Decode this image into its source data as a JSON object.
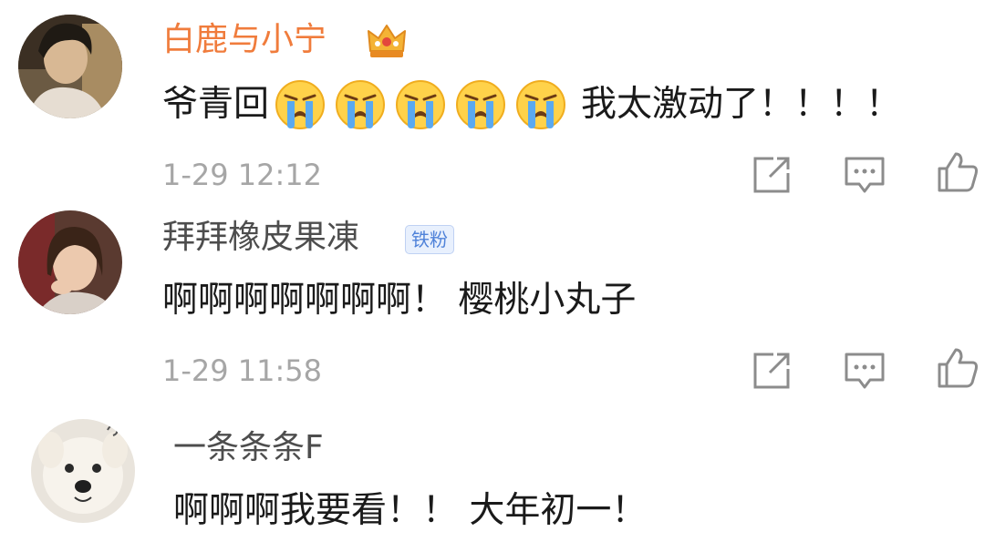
{
  "comments": [
    {
      "username": "白鹿与小宁",
      "has_crown": true,
      "text_before": "爷青回",
      "emojis": [
        "crying-face-emoji",
        "crying-face-emoji",
        "crying-face-emoji",
        "crying-face-emoji",
        "crying-face-emoji"
      ],
      "text_after": "我太激动了！！！！",
      "time": "1-29 12:12"
    },
    {
      "username": "拜拜橡皮果凍",
      "badge": "铁粉",
      "text": "啊啊啊啊啊啊啊！ 樱桃小丸子",
      "time": "1-29 11:58"
    },
    {
      "username": "一条条条F",
      "text": "啊啊啊我要看！！ 大年初一！"
    }
  ],
  "icons": {
    "share": "share-icon",
    "comment": "comment-icon",
    "like": "thumbs-up-icon",
    "crown": "crown-icon"
  },
  "colors": {
    "vip_name": "#f07c3c",
    "username": "#4d4d4d",
    "text": "#1a1a1a",
    "time": "#a6a6a6",
    "badge_bg": "#e8f0fd",
    "badge_text": "#4f82d9",
    "icon": "#8c8c8c"
  }
}
